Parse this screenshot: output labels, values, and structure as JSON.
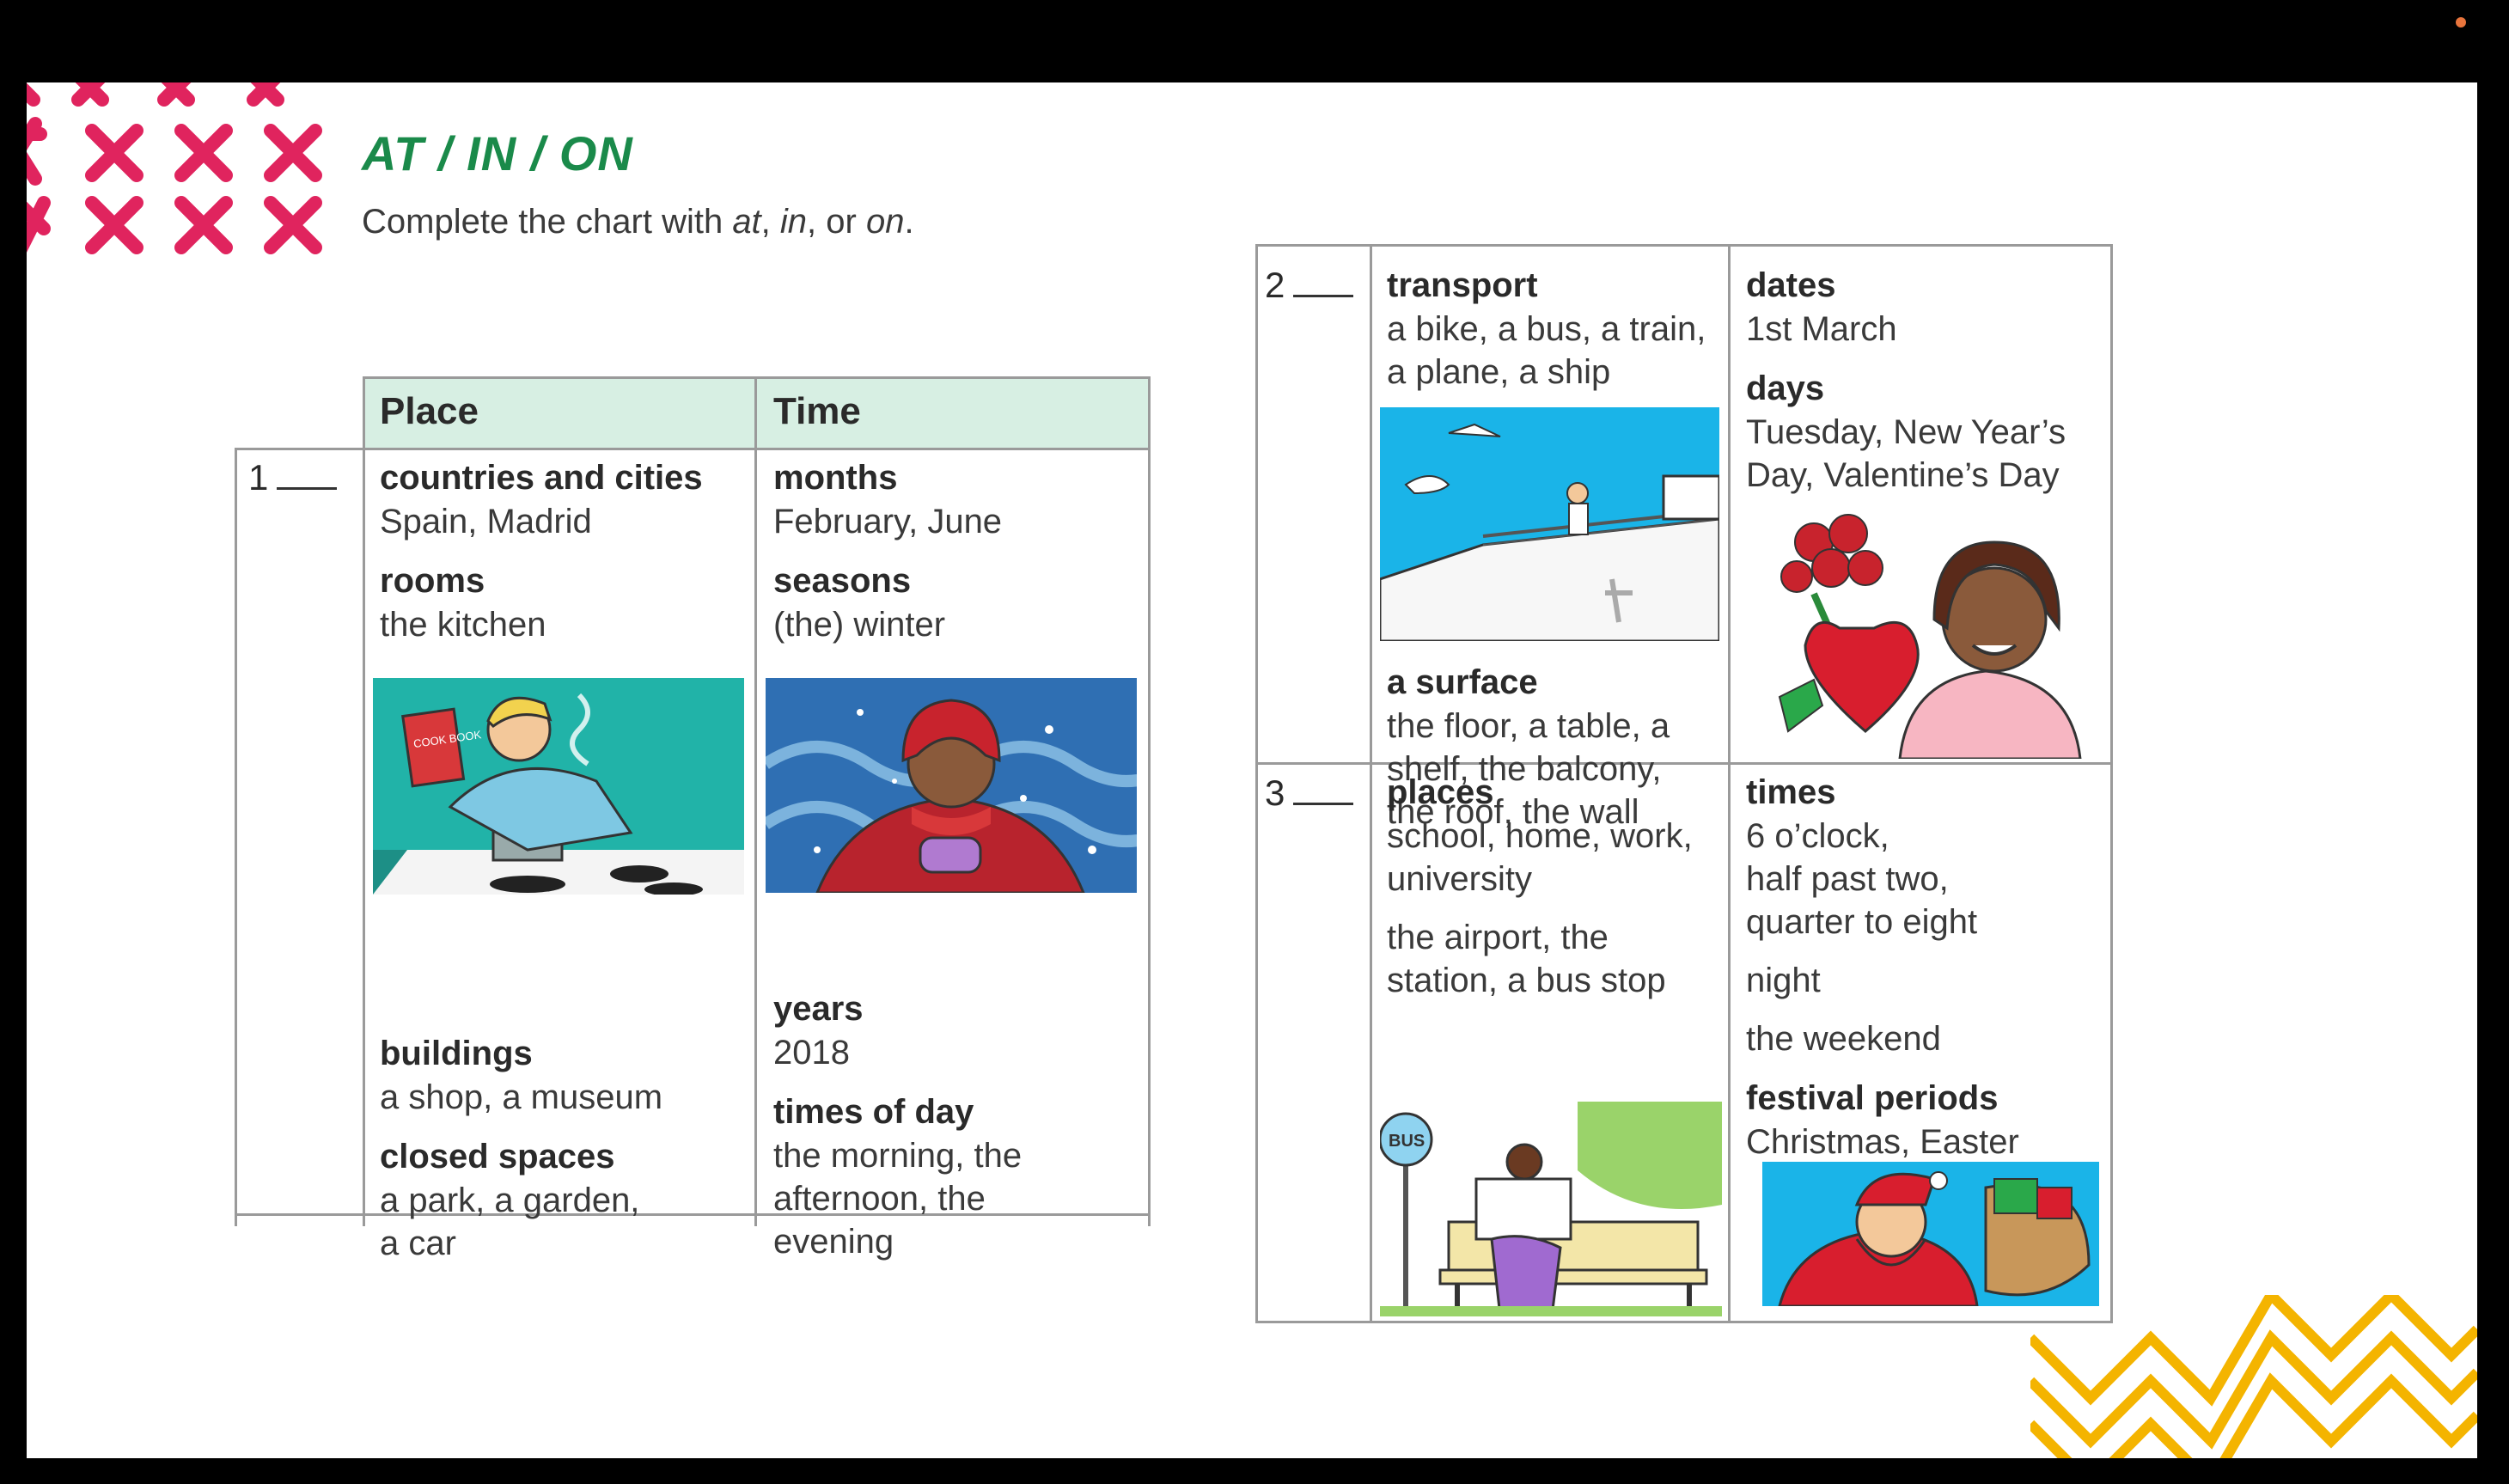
{
  "slide": {
    "title": "AT / IN / ON",
    "instruction": {
      "prefix": "Complete the chart with ",
      "w1": "at",
      "sep1": ", ",
      "w2": "in",
      "sep2": ", or ",
      "w3": "on",
      "suffix": "."
    }
  },
  "table1": {
    "headers": {
      "place": "Place",
      "time": "Time"
    },
    "row_number": "1",
    "place": {
      "countries_heading": "countries and cities",
      "countries_items": "Spain, Madrid",
      "rooms_heading": "rooms",
      "rooms_items": "the kitchen",
      "buildings_heading": "buildings",
      "buildings_items": "a shop, a museum",
      "closed_heading": "closed spaces",
      "closed_items_1": "a park, a garden,",
      "closed_items_2": "a car"
    },
    "time": {
      "months_heading": "months",
      "months_items": "February, June",
      "seasons_heading": "seasons",
      "seasons_items": "(the) winter",
      "years_heading": "years",
      "years_items": "2018",
      "times_heading": "times of day",
      "times_items_1": "the morning, the",
      "times_items_2": "afternoon, the",
      "times_items_3": "evening"
    },
    "cookbook_text": "COOK BOOK"
  },
  "table2": {
    "row2_number": "2",
    "row3_number": "3",
    "row2_place": {
      "transport_heading": "transport",
      "transport_items_1": "a bike, a bus, a train,",
      "transport_items_2": "a plane, a ship",
      "surface_heading": "a surface",
      "surface_items_1": "the floor, a table, a",
      "surface_items_2": "shelf, the balcony,",
      "surface_items_3": "the roof, the wall"
    },
    "row2_time": {
      "dates_heading": "dates",
      "dates_items": "1st March",
      "days_heading": "days",
      "days_items_1": "Tuesday, New Year’s",
      "days_items_2": "Day, Valentine’s Day"
    },
    "row3_place": {
      "places_heading": "places",
      "places_items_1": "school, home, work,",
      "places_items_2": "university",
      "places_items_3": "the airport, the",
      "places_items_4": "station, a bus stop"
    },
    "row3_time": {
      "times_heading": "times",
      "times_items_1": "6 o’clock,",
      "times_items_2": "half past two,",
      "times_items_3": "quarter to eight",
      "night": "night",
      "weekend": "the weekend",
      "festival_heading": "festival periods",
      "festival_items": "Christmas, Easter"
    },
    "bus_sign": "BUS"
  },
  "colors": {
    "accent_green": "#1a8a4a",
    "header_fill": "#d7efe3",
    "deco_pink": "#e0245e",
    "deco_yellow": "#f4b400"
  }
}
